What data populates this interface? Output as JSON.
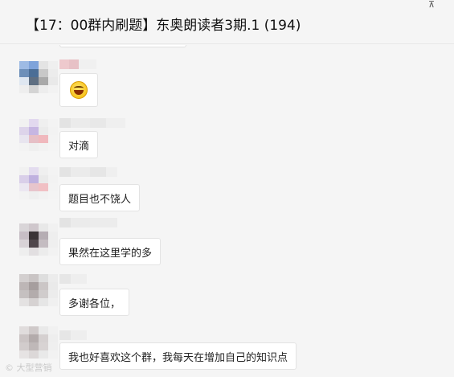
{
  "window": {
    "title": "【17：00群内刷题】东奥朗读者3期.1 (194)",
    "pin_glyph": "⊼"
  },
  "messages": [
    {
      "type": "emoji",
      "emoji": "grinning-face"
    },
    {
      "type": "text",
      "text": "对滴"
    },
    {
      "type": "text",
      "text": "题目也不饶人"
    },
    {
      "type": "text",
      "text": "果然在这里学的多"
    },
    {
      "type": "text",
      "text": "多谢各位，"
    },
    {
      "type": "text",
      "text": "我也好喜欢这个群，我每天在增加自己的知识点"
    }
  ],
  "watermark": "© 大型营销"
}
